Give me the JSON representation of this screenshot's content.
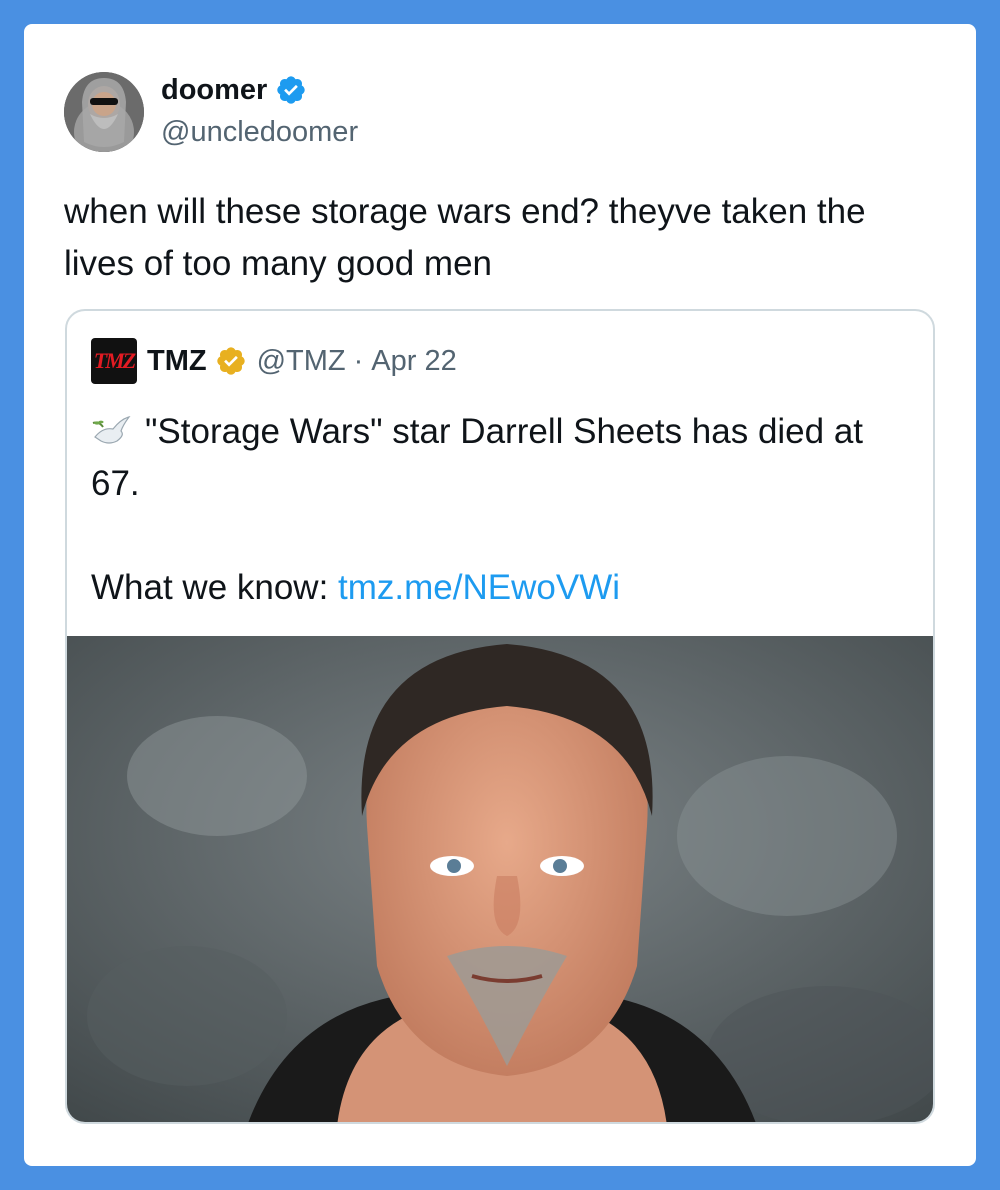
{
  "tweet": {
    "author": {
      "display_name": "doomer",
      "handle": "@uncledoomer",
      "avatar_icon": "avatar-bearded-man-sunglasses",
      "verified": true,
      "verified_color": "#1d9bf0"
    },
    "text": "when will these storage wars end? theyve taken the lives of too many good men"
  },
  "quoted_tweet": {
    "author": {
      "display_name": "TMZ",
      "handle": "@TMZ",
      "logo_text": "TMZ",
      "verified": true,
      "verified_color": "#e8b020"
    },
    "meta_separator": "·",
    "date": "Apr 22",
    "text_emoji": "dove-icon",
    "text_main": "\"Storage Wars\" star Darrell Sheets has died at 67.",
    "text_prefix": "What we know:",
    "link": "tmz.me/NEwoVWi",
    "image_icon": "photo-man-portrait"
  },
  "colors": {
    "frame": "#4a90e2",
    "link": "#1d9bf0",
    "secondary_text": "#536471"
  }
}
